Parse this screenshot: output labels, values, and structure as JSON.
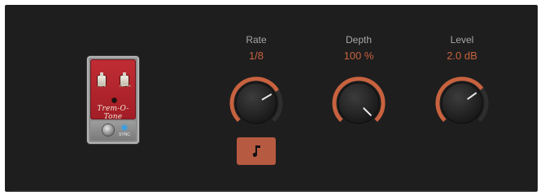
{
  "pedal": {
    "name": "Trem-O-Tone",
    "knob_left_label": "RATE",
    "knob_right_label": "DEPTH",
    "sync_label": "SYNC"
  },
  "knobs": [
    {
      "label": "Rate",
      "value": "1/8",
      "level": 0.72
    },
    {
      "label": "Depth",
      "value": "100 %",
      "level": 1.0
    },
    {
      "label": "Level",
      "value": "2.0 dB",
      "level": 0.7
    }
  ],
  "note_button": {
    "icon": "music-note-icon"
  },
  "colors": {
    "panel": "#1e1e1e",
    "accent": "#c8623f",
    "button": "#b65a42",
    "label": "#a7a7a7"
  }
}
